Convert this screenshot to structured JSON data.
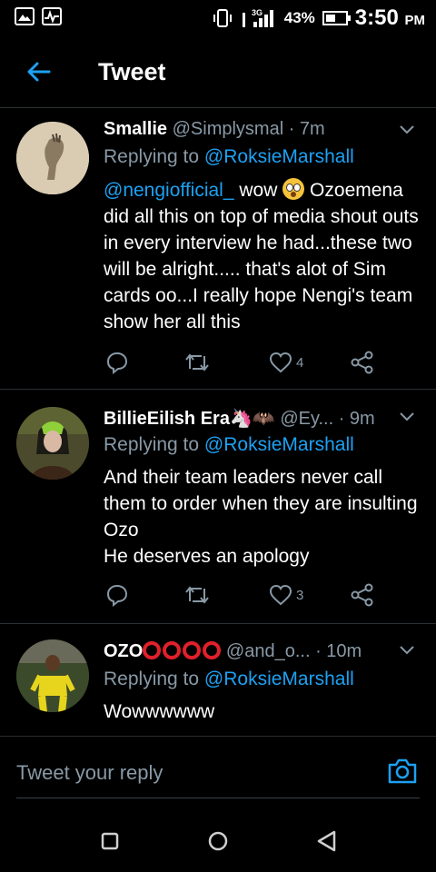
{
  "status": {
    "network": "3G",
    "battery": "43%",
    "time": "3:50",
    "ampm": "PM"
  },
  "header": {
    "title": "Tweet"
  },
  "tweets": [
    {
      "name": "Smallie",
      "handle": "@Simplysmal",
      "time": "· 7m",
      "replying_to": "Replying to",
      "reply_mention": "@RoksieMarshall",
      "mention": "@nengiofficial_",
      "text_a": " wow ",
      "text_b": " Ozoemena did all this on top of media shout outs in every interview he had...these two will be alright..... that's alot of Sim cards oo...I really hope Nengi's team show her all this",
      "likes": "4"
    },
    {
      "name": "BillieEilish Era🦄🦇",
      "handle": "@Ey...",
      "time": "· 9m",
      "replying_to": "Replying to",
      "reply_mention": "@RoksieMarshall",
      "text": "And their team leaders never call them to order when they are insulting Ozo\nHe deserves an apology",
      "likes": "3"
    },
    {
      "name": "OZO",
      "handle": "@and_o...",
      "time": "· 10m",
      "replying_to": "Replying to",
      "reply_mention": "@RoksieMarshall",
      "text": "Wowwwwww"
    }
  ],
  "composer": {
    "placeholder": "Tweet your reply"
  },
  "colors": {
    "accent": "#1da1f2",
    "muted": "#8899a6",
    "background": "#000000"
  },
  "icons": [
    "back-arrow-icon",
    "reply-icon",
    "retweet-icon",
    "like-icon",
    "share-icon",
    "camera-icon",
    "more-caret-icon"
  ]
}
